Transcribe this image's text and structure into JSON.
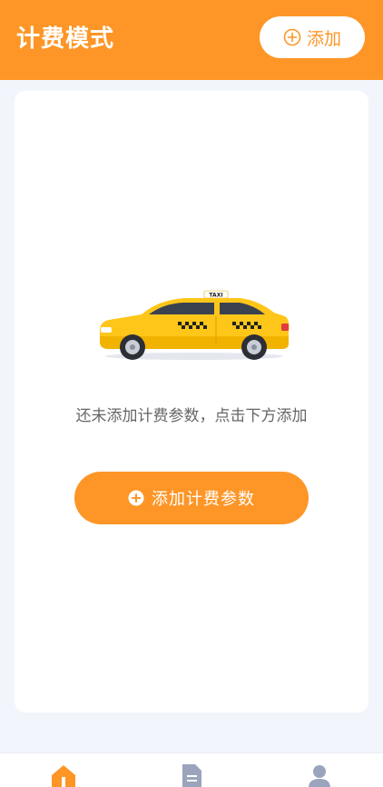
{
  "header": {
    "title": "计费模式",
    "add_button_label": "添加",
    "add_icon": "plus-circle-icon"
  },
  "empty_state": {
    "image": "taxi-illustration",
    "taxi_sign_text": "TAXI",
    "message": "还未添加计费参数，点击下方添加",
    "button_label": "添加计费参数",
    "button_icon": "plus-circle-filled-icon"
  },
  "tabbar": {
    "items": [
      {
        "icon": "home-icon",
        "active": true
      },
      {
        "icon": "document-icon",
        "active": false
      },
      {
        "icon": "user-icon",
        "active": false
      }
    ]
  },
  "colors": {
    "accent": "#fd9627",
    "background": "#f2f5fb",
    "inactive_icon": "#9aa4bd"
  }
}
